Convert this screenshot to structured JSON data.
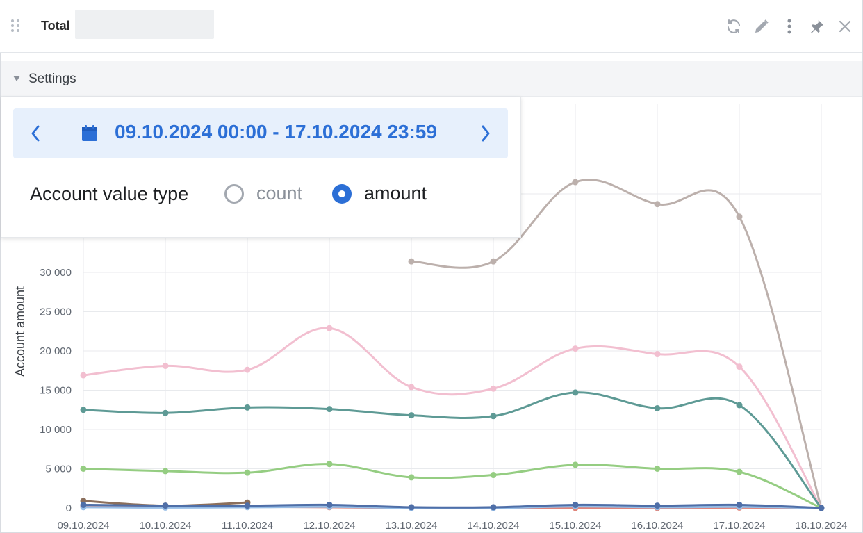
{
  "header": {
    "title": "Total",
    "icons": [
      "refresh-icon",
      "edit-icon",
      "more-vertical-icon",
      "pin-icon",
      "close-icon"
    ]
  },
  "settings": {
    "label": "Settings",
    "date_range": "09.10.2024 00:00 - 17.10.2024 23:59",
    "account_value_type_label": "Account value type",
    "options": [
      {
        "label": "count",
        "selected": false
      },
      {
        "label": "amount",
        "selected": true
      }
    ]
  },
  "colors": {
    "accent": "#2c6fd6",
    "range_bg": "#e7f0fc"
  },
  "chart_data": {
    "type": "line",
    "ylabel": "Account amount",
    "xlabel": "",
    "x": [
      "09.10.2024",
      "10.10.2024",
      "11.10.2024",
      "12.10.2024",
      "13.10.2024",
      "14.10.2024",
      "15.10.2024",
      "16.10.2024",
      "17.10.2024",
      "18.10.2024"
    ],
    "ylim": [
      0,
      42000
    ],
    "yticks": [
      0,
      5000,
      10000,
      15000,
      20000,
      25000,
      30000
    ],
    "ytick_labels": [
      "0",
      "5 000",
      "10 000",
      "15 000",
      "20 000",
      "25 000",
      "30 000"
    ],
    "grid": true,
    "legend": "none",
    "series": [
      {
        "color": "#bcb0ac",
        "values": [
          null,
          null,
          null,
          null,
          31400,
          31400,
          41500,
          38700,
          37100,
          0
        ]
      },
      {
        "color": "#f2bfd0",
        "values": [
          16900,
          18100,
          17600,
          22900,
          15400,
          15200,
          20300,
          19600,
          18000,
          0
        ]
      },
      {
        "color": "#5e9a95",
        "values": [
          12500,
          12100,
          12800,
          12600,
          11800,
          11700,
          14700,
          12700,
          13100,
          0
        ]
      },
      {
        "color": "#95cd82",
        "values": [
          5000,
          4700,
          4500,
          5600,
          3900,
          4200,
          5500,
          5000,
          4600,
          0
        ]
      },
      {
        "color": "#8b6f5c",
        "values": [
          900,
          300,
          700,
          null,
          null,
          null,
          null,
          null,
          null,
          null
        ]
      },
      {
        "color": "#e0847a",
        "values": [
          200,
          100,
          150,
          100,
          0,
          0,
          0,
          0,
          50,
          0
        ]
      },
      {
        "color": "#96bde6",
        "values": [
          100,
          50,
          100,
          150,
          0,
          0,
          200,
          100,
          150,
          0
        ]
      },
      {
        "color": "#4f6fa8",
        "values": [
          400,
          300,
          300,
          400,
          100,
          100,
          400,
          300,
          400,
          0
        ]
      }
    ]
  }
}
